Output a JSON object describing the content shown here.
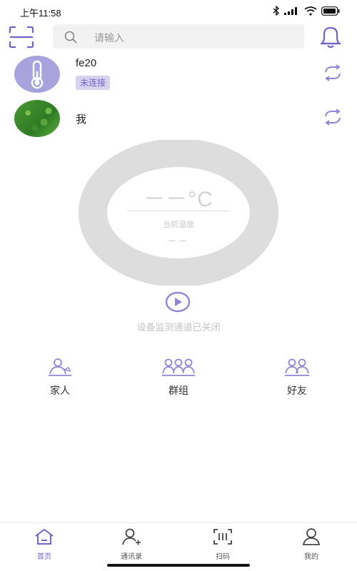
{
  "status_bar": {
    "time": "上午11:58",
    "icons": [
      "bluetooth-icon",
      "signal-icon",
      "wifi-icon",
      "battery-icon"
    ]
  },
  "header": {
    "scan_icon": "scan-icon",
    "search": {
      "placeholder": "请输入",
      "icon": "search-icon"
    },
    "bell_icon": "bell-icon"
  },
  "devices": [
    {
      "name": "fe20",
      "status": "未连接",
      "avatar": "thermometer-icon",
      "action_icon": "refresh-icon"
    },
    {
      "name": "我",
      "status": "",
      "avatar": "photo",
      "action_icon": "refresh-icon"
    }
  ],
  "gauge": {
    "temperature": "－－°C",
    "temperature_label": "当前温度",
    "humidity": "－－"
  },
  "channel": {
    "play_icon": "play-icon",
    "status_text": "设备监测通道已关闭"
  },
  "categories": [
    {
      "label": "家人",
      "icon": "family-icon"
    },
    {
      "label": "群组",
      "icon": "group-icon"
    },
    {
      "label": "好友",
      "icon": "friends-icon"
    }
  ],
  "bottom_nav": [
    {
      "label": "首页",
      "icon": "home-icon",
      "active": true
    },
    {
      "label": "通讯录",
      "icon": "contacts-icon",
      "active": false
    },
    {
      "label": "扫码",
      "icon": "scan-code-icon",
      "active": false
    },
    {
      "label": "我的",
      "icon": "profile-icon",
      "active": false
    }
  ],
  "colors": {
    "accent": "#7065c9",
    "accent_light": "#d7d3ee",
    "gauge_ring": "#dddddd",
    "muted_text": "#c4c4c4"
  }
}
